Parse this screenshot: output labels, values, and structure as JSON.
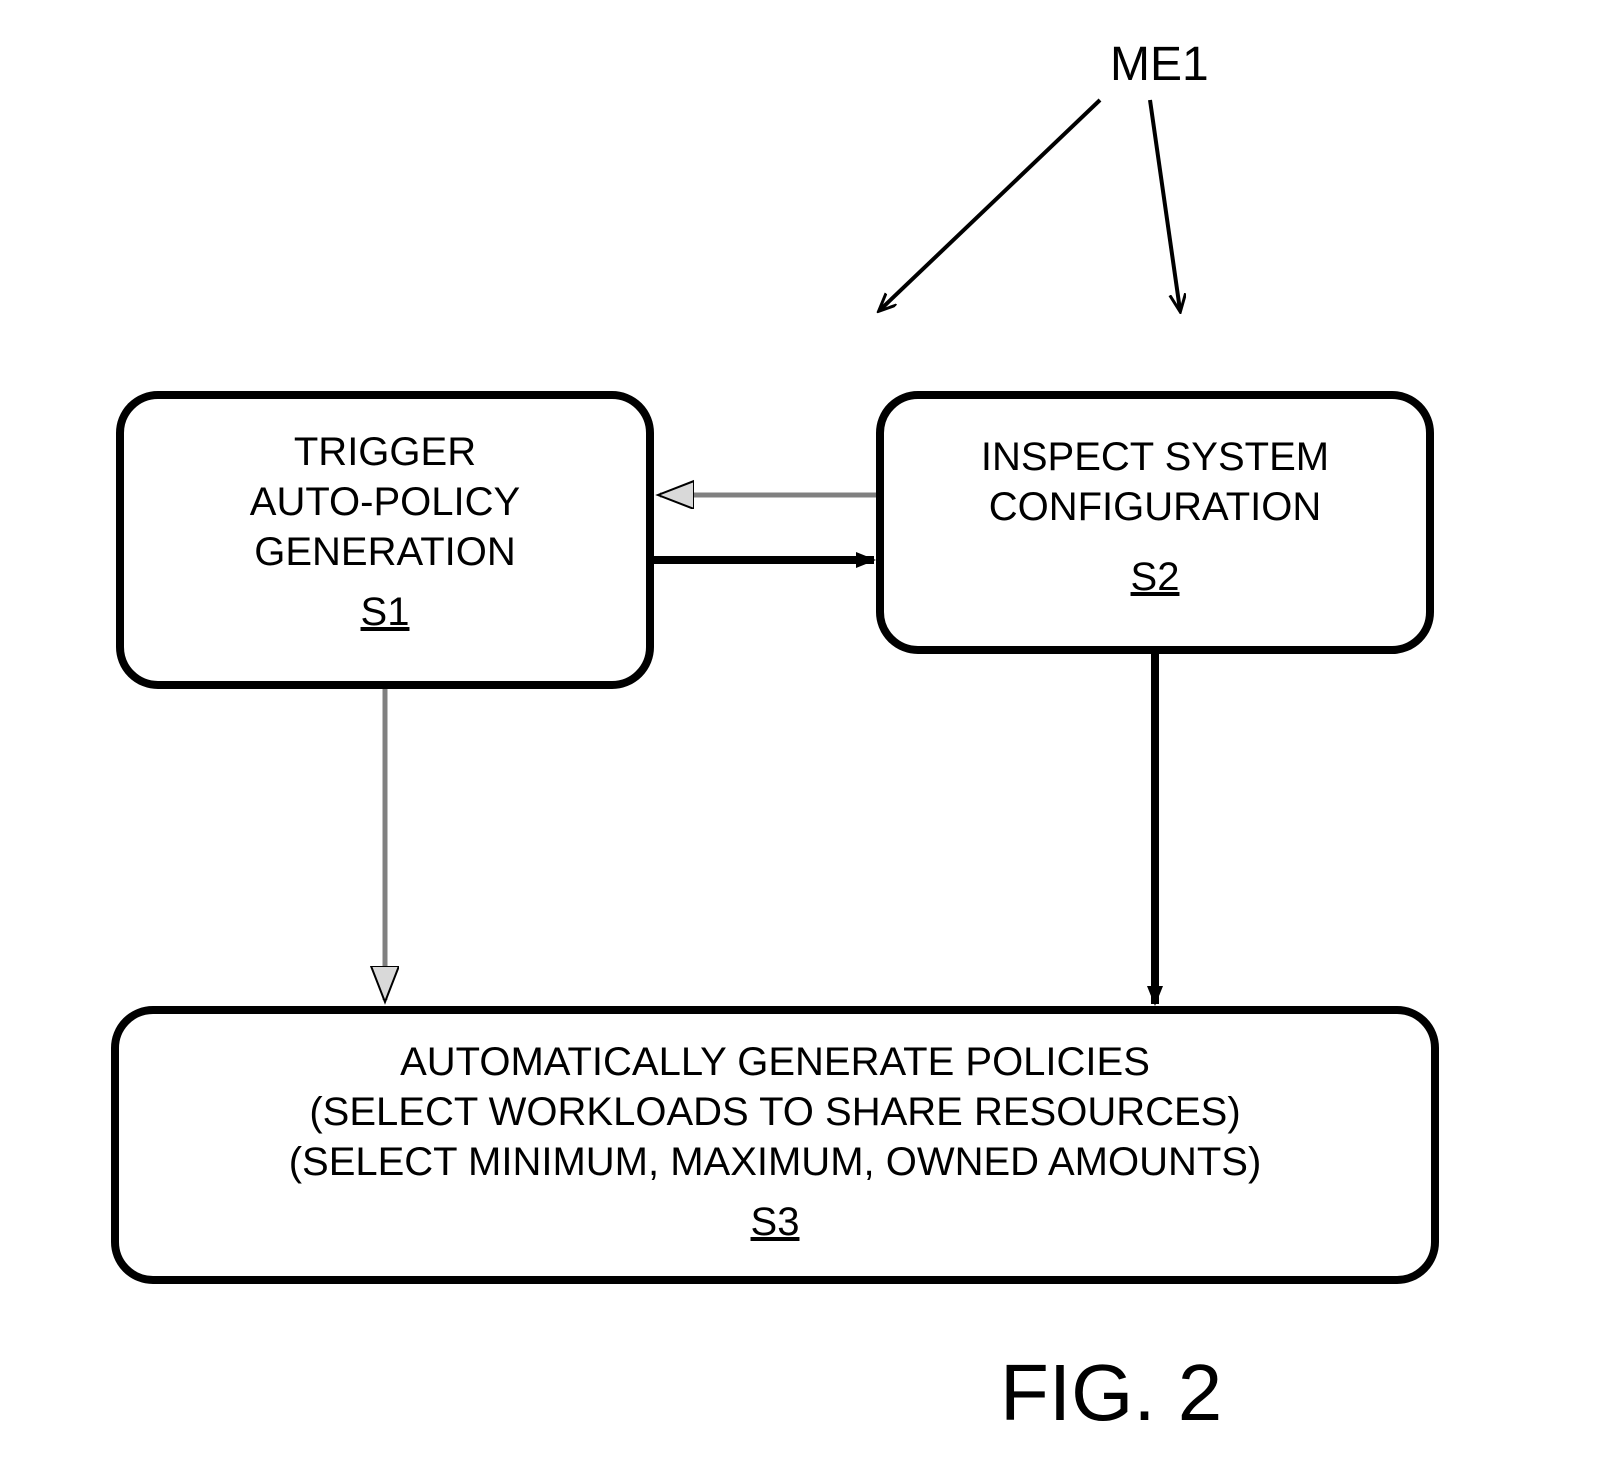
{
  "label_top": "ME1",
  "box1": {
    "line1": "TRIGGER",
    "line2": "AUTO-POLICY",
    "line3": "GENERATION",
    "id": "S1"
  },
  "box2": {
    "line1": "INSPECT SYSTEM",
    "line2": "CONFIGURATION",
    "id": "S2"
  },
  "box3": {
    "line1": "AUTOMATICALLY GENERATE POLICIES",
    "line2": "(SELECT WORKLOADS TO SHARE RESOURCES)",
    "line3": "(SELECT  MINIMUM, MAXIMUM, OWNED AMOUNTS)",
    "id": "S3"
  },
  "figure_label": "FIG. 2"
}
